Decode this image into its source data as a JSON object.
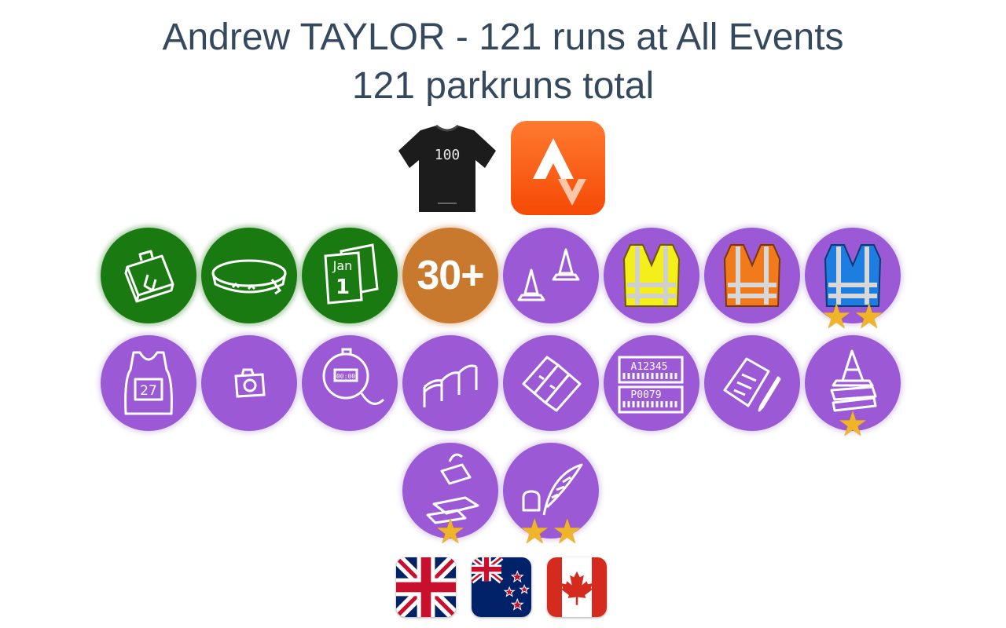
{
  "header": {
    "title_line1": "Andrew TAYLOR - 121 runs at All Events",
    "title_line2": "121 parkruns total"
  },
  "milestones": [
    {
      "name": "100-club-tshirt",
      "icon": "tshirt-100-icon",
      "label": "100"
    },
    {
      "name": "strava",
      "icon": "strava-icon"
    }
  ],
  "badges_row1": [
    {
      "icon": "suitcase-icon",
      "color": "#1a7a12"
    },
    {
      "icon": "wristband-icon",
      "color": "#1a7a12"
    },
    {
      "icon": "calendar-jan-1-icon",
      "color": "#1a7a12",
      "label_month": "Jan",
      "label_day": "1"
    },
    {
      "icon": "thirty-plus-icon",
      "color": "#c8792e",
      "label": "30+"
    },
    {
      "icon": "cones-icon",
      "color": "#9b59d6"
    },
    {
      "icon": "yellow-vest-icon",
      "color": "#9b59d6"
    },
    {
      "icon": "orange-vest-icon",
      "color": "#9b59d6"
    },
    {
      "icon": "blue-vest-icon",
      "color": "#9b59d6",
      "stars": 2
    }
  ],
  "badges_row2": [
    {
      "icon": "running-vest-27-icon",
      "label": "27"
    },
    {
      "icon": "camera-icon"
    },
    {
      "icon": "stopwatch-icon",
      "label": "00:00"
    },
    {
      "icon": "funnel-posts-icon"
    },
    {
      "icon": "tokens-icon"
    },
    {
      "icon": "barcodes-icon",
      "label_top": "A12345",
      "label_bottom": "P0079"
    },
    {
      "icon": "clipboard-pen-icon"
    },
    {
      "icon": "cone-stack-icon",
      "stars": 1
    }
  ],
  "badges_row3": [
    {
      "icon": "token-sorting-icon",
      "stars": 1
    },
    {
      "icon": "quill-ink-icon",
      "stars": 2
    }
  ],
  "flags": [
    {
      "icon": "uk-flag-icon",
      "country": "United Kingdom"
    },
    {
      "icon": "new-zealand-flag-icon",
      "country": "New Zealand"
    },
    {
      "icon": "canada-flag-icon",
      "country": "Canada"
    }
  ],
  "colors": {
    "volunteer_purple": "#9b59d6",
    "green": "#1a7a12",
    "orange": "#c8792e",
    "star": "#f0b429",
    "strava": "#fc4c02"
  }
}
